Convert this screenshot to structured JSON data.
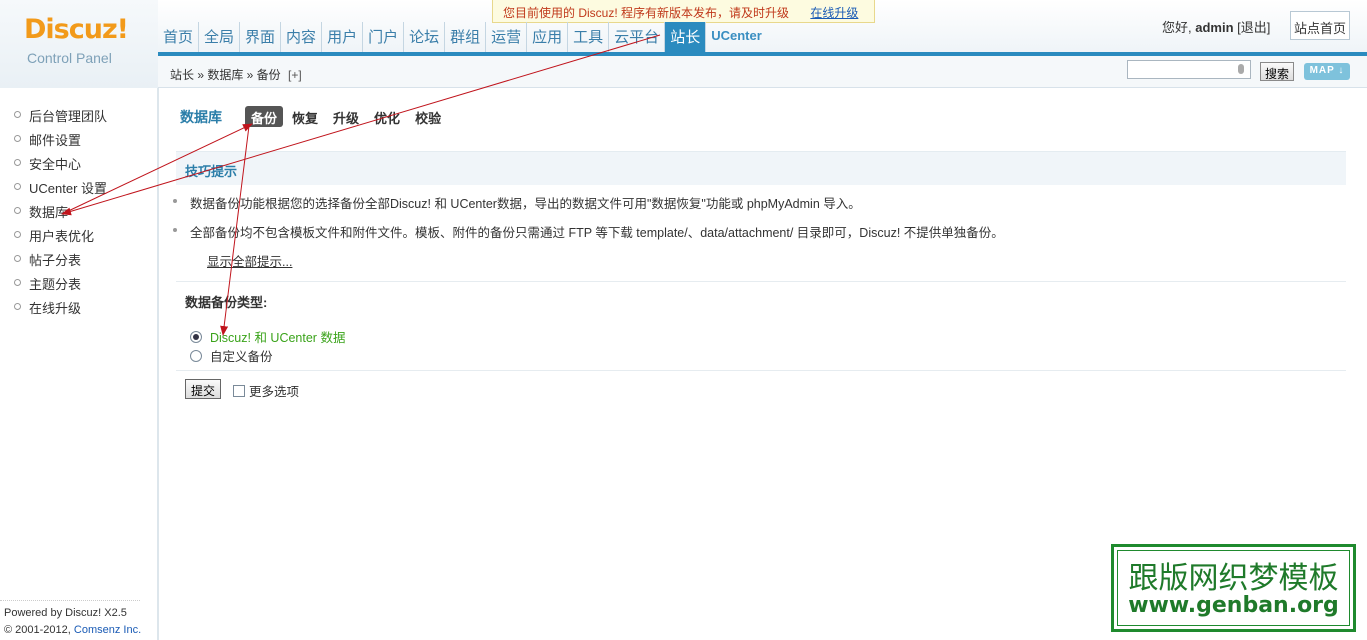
{
  "logo": {
    "brand": "Discuz!",
    "subtitle": "Control Panel"
  },
  "notice": {
    "text": "您目前使用的 Discuz! 程序有新版本发布，请及时升级",
    "link": "在线升级"
  },
  "nav": {
    "items": [
      "首页",
      "全局",
      "界面",
      "内容",
      "用户",
      "门户",
      "论坛",
      "群组",
      "运营",
      "应用",
      "工具",
      "云平台",
      "站长",
      "UCenter"
    ],
    "active": "站长"
  },
  "user": {
    "greeting": "您好,",
    "name": "admin",
    "logout": "[退出]",
    "site_home": "站点首页"
  },
  "breadcrumb": {
    "text": "站长 » 数据库 » 备份",
    "plus": "[+]"
  },
  "search": {
    "value": "",
    "button": "搜索",
    "map": "MAP ↓"
  },
  "sidebar": {
    "items": [
      "后台管理团队",
      "邮件设置",
      "安全中心",
      "UCenter 设置",
      "数据库",
      "用户表优化",
      "帖子分表",
      "主题分表",
      "在线升级"
    ],
    "footer_powered": "Powered by Discuz! X2.5",
    "footer_copy": "© 2001-2012, ",
    "footer_company": "Comsenz Inc."
  },
  "main": {
    "title": "数据库",
    "tabs": [
      "备份",
      "恢复",
      "升级",
      "优化",
      "校验"
    ],
    "active_tab": "备份",
    "tips_title": "技巧提示",
    "tips": [
      "数据备份功能根据您的选择备份全部Discuz! 和 UCenter数据，导出的数据文件可用\"数据恢复\"功能或 phpMyAdmin 导入。",
      "全部备份均不包含模板文件和附件文件。模板、附件的备份只需通过 FTP 等下载 template/、data/attachment/ 目录即可，Discuz! 不提供单独备份。"
    ],
    "show_all": "显示全部提示...",
    "type_label": "数据备份类型:",
    "options": [
      "Discuz! 和 UCenter 数据",
      "自定义备份"
    ],
    "selected_option": "Discuz! 和 UCenter 数据",
    "submit": "提交",
    "more_options": "更多选项"
  },
  "watermark": {
    "line1": "跟版网织梦模板",
    "line2": "www.genban.org"
  },
  "colors": {
    "accent": "#2b8bbf",
    "arrow": "#c0141c",
    "selected_option": "#3aa31a",
    "watermark": "#1f8a2e"
  }
}
